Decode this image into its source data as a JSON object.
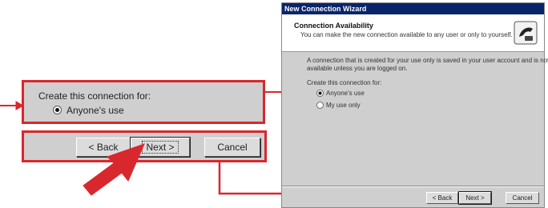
{
  "callout_radio": {
    "title": "Create this connection for:",
    "option_label": "Anyone's use",
    "option_accel": "A"
  },
  "callout_buttons": {
    "back_label": "< Back",
    "next_label": "Next >",
    "cancel_label": "Cancel"
  },
  "dialog": {
    "window_title": "New Connection Wizard",
    "header_title": "Connection Availability",
    "header_subtitle": "You can make the new connection available to any user or only to yourself.",
    "description_line1": "A connection that is created for your use only is saved in your user account and is not",
    "description_line2": "available unless you are logged on.",
    "group_label": "Create this connection for:",
    "options": [
      {
        "label": "Anyone's use",
        "checked": true
      },
      {
        "label": "My use only",
        "checked": false
      }
    ],
    "buttons": {
      "back": "< Back",
      "next": "Next >",
      "cancel": "Cancel"
    }
  },
  "colors": {
    "callout_red": "#d9272e",
    "titlebar_blue": "#0a246a",
    "dialog_gray": "#cfcfcf"
  },
  "icons": [
    "wizard-phone-icon",
    "pointer-arrow-icon"
  ]
}
